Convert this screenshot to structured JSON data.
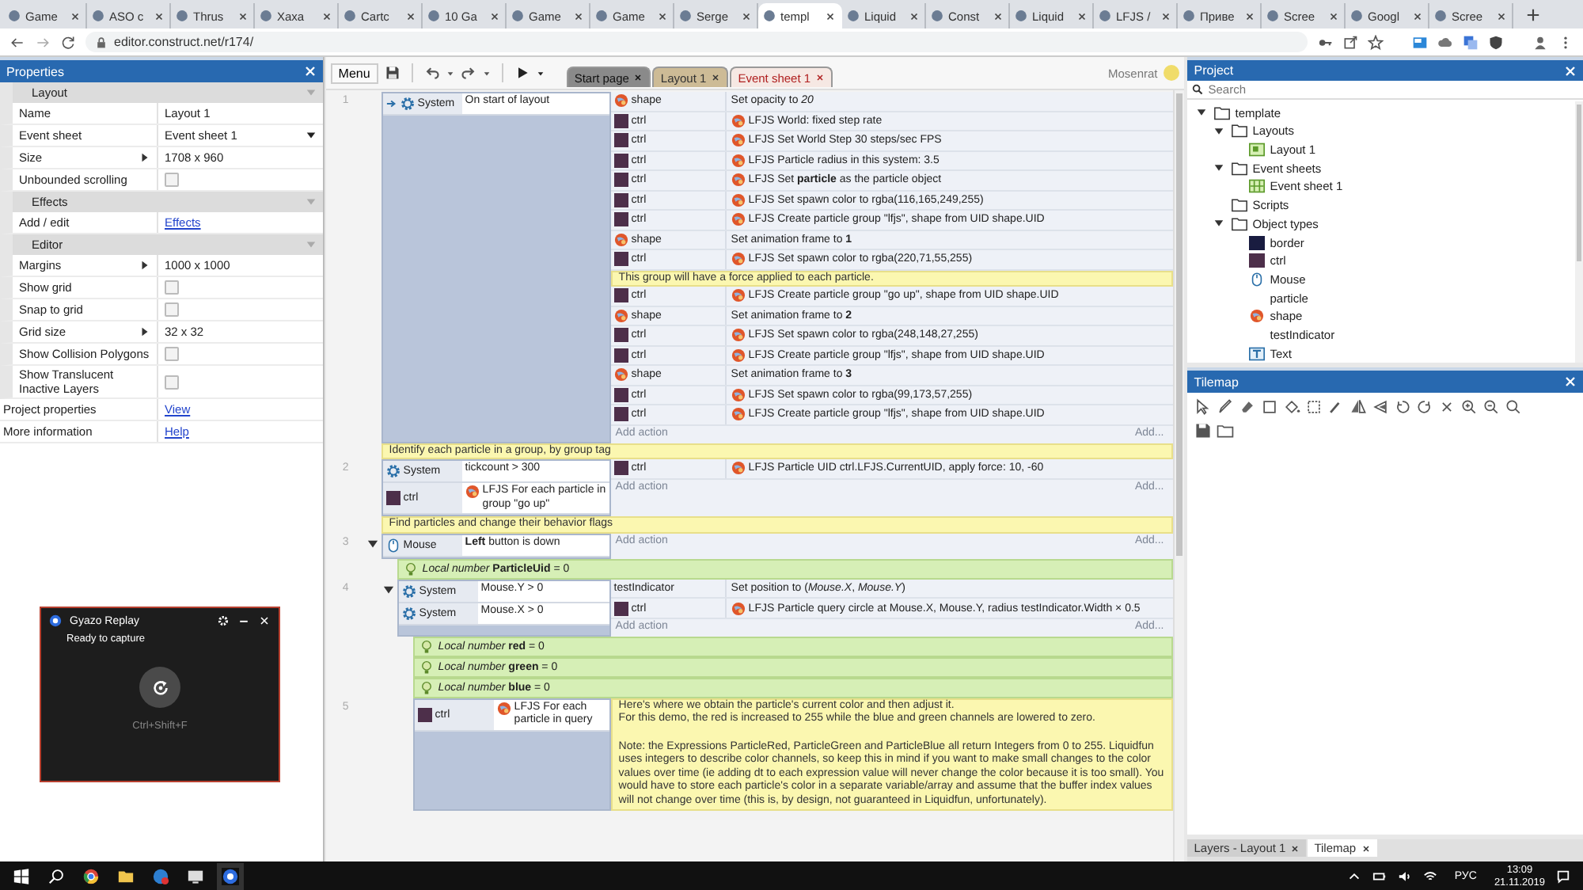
{
  "browser": {
    "tabs": [
      {
        "title": "Game",
        "selected": false
      },
      {
        "title": "ASO c",
        "selected": false
      },
      {
        "title": "Thrus",
        "selected": false
      },
      {
        "title": "Xaxa",
        "selected": false
      },
      {
        "title": "Cartc",
        "selected": false
      },
      {
        "title": "10 Ga",
        "selected": false
      },
      {
        "title": "Game",
        "selected": false
      },
      {
        "title": "Game",
        "selected": false
      },
      {
        "title": "Serge",
        "selected": false
      },
      {
        "title": "templ",
        "selected": true
      },
      {
        "title": "Liquid",
        "selected": false
      },
      {
        "title": "Const",
        "selected": false
      },
      {
        "title": "Liquid",
        "selected": false
      },
      {
        "title": "LFJS /",
        "selected": false
      },
      {
        "title": "Приве",
        "selected": false
      },
      {
        "title": "Scree",
        "selected": false
      },
      {
        "title": "Googl",
        "selected": false
      },
      {
        "title": "Scree",
        "selected": false
      }
    ],
    "url": "editor.construct.net/r174/"
  },
  "properties": {
    "title": "Properties",
    "sections": [
      {
        "title": "Layout",
        "expanded": true,
        "rows": [
          {
            "kind": "text",
            "label": "Name",
            "value": "Layout 1"
          },
          {
            "kind": "dropdown",
            "label": "Event sheet",
            "value": "Event sheet 1"
          },
          {
            "kind": "expand",
            "label": "Size",
            "value": "1708 x 960"
          },
          {
            "kind": "checkbox",
            "label": "Unbounded scrolling",
            "checked": false
          }
        ]
      },
      {
        "title": "Effects",
        "expanded": true,
        "rows": [
          {
            "kind": "link",
            "label": "Add / edit",
            "value": "Effects"
          }
        ]
      },
      {
        "title": "Editor",
        "expanded": true,
        "rows": [
          {
            "kind": "expand",
            "label": "Margins",
            "value": "1000 x 1000"
          },
          {
            "kind": "checkbox",
            "label": "Show grid",
            "checked": false
          },
          {
            "kind": "checkbox",
            "label": "Snap to grid",
            "checked": false
          },
          {
            "kind": "expand",
            "label": "Grid size",
            "value": "32 x 32"
          },
          {
            "kind": "checkbox",
            "label": "Show Collision Polygons",
            "checked": false
          },
          {
            "kind": "checkbox",
            "label": "Show Translucent Inactive Layers",
            "checked": false
          }
        ]
      }
    ],
    "rows": [
      {
        "kind": "link",
        "label": "Project properties",
        "value": "View"
      },
      {
        "kind": "link",
        "label": "More information",
        "value": "Help"
      }
    ]
  },
  "toolbar": {
    "menu": "Menu",
    "tabs": [
      {
        "kind": "start",
        "label": "Start page",
        "selected": false
      },
      {
        "kind": "layout",
        "label": "Layout 1",
        "selected": false
      },
      {
        "kind": "sheet",
        "label": "Event sheet 1",
        "selected": true
      }
    ],
    "user": "Mosenrat"
  },
  "sheet": {
    "events": [
      {
        "kind": "event",
        "number": "1",
        "conditions": [
          {
            "kind": "system",
            "object": "System",
            "trigger": true,
            "text": "On start of layout"
          }
        ],
        "actions": [
          {
            "kind": "shape",
            "object": "shape",
            "text": "Set opacity to *20*"
          },
          {
            "kind": "sprite",
            "object": "ctrl",
            "behavior": true,
            "text": "LFJS World: fixed step rate"
          },
          {
            "kind": "sprite",
            "object": "ctrl",
            "behavior": true,
            "text": "LFJS Set World Step 30 steps/sec FPS"
          },
          {
            "kind": "sprite",
            "object": "ctrl",
            "behavior": true,
            "text": "LFJS Particle radius in this system: 3.5"
          },
          {
            "kind": "sprite",
            "object": "ctrl",
            "behavior": true,
            "text": "LFJS Set **particle** as the particle object"
          },
          {
            "kind": "sprite",
            "object": "ctrl",
            "behavior": true,
            "text": "LFJS Set spawn color to rgba(116,165,249,255)"
          },
          {
            "kind": "sprite",
            "object": "ctrl",
            "behavior": true,
            "text": "LFJS Create particle group \"lfjs\", shape from UID shape.UID"
          },
          {
            "kind": "shape",
            "object": "shape",
            "text": "Set animation frame to **1**"
          },
          {
            "kind": "sprite",
            "object": "ctrl",
            "behavior": true,
            "text": "LFJS Set spawn color to rgba(220,71,55,255)"
          },
          {
            "kind": "comment",
            "text": "This group will have a force applied to each particle."
          },
          {
            "kind": "sprite",
            "object": "ctrl",
            "behavior": true,
            "text": "LFJS Create particle group \"go up\", shape from UID shape.UID"
          },
          {
            "kind": "shape",
            "object": "shape",
            "text": "Set animation frame to **2**"
          },
          {
            "kind": "sprite",
            "object": "ctrl",
            "behavior": true,
            "text": "LFJS Set spawn color to rgba(248,148,27,255)"
          },
          {
            "kind": "sprite",
            "object": "ctrl",
            "behavior": true,
            "text": "LFJS Create particle group \"lfjs\", shape from UID shape.UID"
          },
          {
            "kind": "shape",
            "object": "shape",
            "text": "Set animation frame to **3**"
          },
          {
            "kind": "sprite",
            "object": "ctrl",
            "behavior": true,
            "text": "LFJS Set spawn color to rgba(99,173,57,255)"
          },
          {
            "kind": "sprite",
            "object": "ctrl",
            "behavior": true,
            "text": "LFJS Create particle group \"lfjs\", shape from UID shape.UID"
          }
        ],
        "add_action": "Add action",
        "add": "Add..."
      },
      {
        "kind": "comment",
        "text": "Identify each particle in a group, by group tag"
      },
      {
        "kind": "event",
        "number": "2",
        "conditions": [
          {
            "kind": "system",
            "object": "System",
            "text": "tickcount > 300"
          },
          {
            "kind": "sprite",
            "object": "ctrl",
            "behavior": true,
            "text": "LFJS For each particle in group \"go up\""
          }
        ],
        "actions": [
          {
            "kind": "sprite",
            "object": "ctrl",
            "behavior": true,
            "text": "LFJS Particle UID ctrl.LFJS.CurrentUID, apply force: 10, -60"
          }
        ],
        "add_action": "Add action",
        "add": "Add..."
      },
      {
        "kind": "comment",
        "text": "Find particles and change their behavior flags"
      },
      {
        "kind": "event",
        "number": "3",
        "expanded": true,
        "conditions": [
          {
            "kind": "mouse",
            "object": "Mouse",
            "text": "**Left** button is down"
          }
        ],
        "add_action": "Add action",
        "add": "Add...",
        "children": [
          {
            "kind": "variable",
            "text": "*Local number* **ParticleUid** = 0"
          },
          {
            "kind": "event",
            "number": "4",
            "expanded": true,
            "conditions": [
              {
                "kind": "system",
                "object": "System",
                "text": "Mouse.Y > 0"
              },
              {
                "kind": "system",
                "object": "System",
                "text": "Mouse.X > 0"
              }
            ],
            "actions": [
              {
                "kind": "plain",
                "object": "testIndicator",
                "text": "Set position to (*Mouse.X*, *Mouse.Y*)"
              },
              {
                "kind": "sprite",
                "object": "ctrl",
                "behavior": true,
                "text": "LFJS Particle query circle at Mouse.X, Mouse.Y, radius testIndicator.Width × 0.5"
              }
            ],
            "add_action": "Add action",
            "add": "Add...",
            "children": [
              {
                "kind": "variable",
                "text": "*Local number* **red** = 0"
              },
              {
                "kind": "variable",
                "text": "*Local number* **green** = 0"
              },
              {
                "kind": "variable",
                "text": "*Local number* **blue** = 0"
              },
              {
                "kind": "event",
                "number": "5",
                "conditions": [
                  {
                    "kind": "sprite",
                    "object": "ctrl",
                    "behavior": true,
                    "text": "LFJS For each particle in query"
                  }
                ],
                "actions": [
                  {
                    "kind": "comment",
                    "text": "Here's where we obtain the particle's current color and then adjust it.\nFor this demo, the red is increased to 255 while the blue and green channels are lowered to zero.\n\nNote: the Expressions ParticleRed, ParticleGreen and ParticleBlue all return Integers from 0 to 255. Liquidfun uses integers to describe color channels, so keep this in mind if you want to make small changes to the color values over time (ie adding dt to each expression value will never change the color because it is too small). You would have to store each particle's color in a separate variable/array and assume that the buffer index values will not change over time (this is, by design, not guaranteed in Liquidfun, unfortunately)."
                  }
                ]
              }
            ]
          }
        ]
      }
    ]
  },
  "project": {
    "title": "Project",
    "search": {
      "placeholder": "Search"
    },
    "tree": [
      {
        "kind": "folder",
        "label": "template",
        "expanded": true,
        "children": [
          {
            "kind": "folder",
            "label": "Layouts",
            "expanded": true,
            "children": [
              {
                "kind": "layout",
                "label": "Layout 1"
              }
            ]
          },
          {
            "kind": "folder",
            "label": "Event sheets",
            "expanded": true,
            "children": [
              {
                "kind": "eventsheet",
                "label": "Event sheet 1"
              }
            ]
          },
          {
            "kind": "folder",
            "label": "Scripts"
          },
          {
            "kind": "folder",
            "label": "Object types",
            "expanded": true,
            "children": [
              {
                "kind": "sprite",
                "label": "border",
                "color": "#191c40"
              },
              {
                "kind": "sprite",
                "label": "ctrl",
                "color": "#4d2f4a"
              },
              {
                "kind": "mouse",
                "label": "Mouse"
              },
              {
                "kind": "plain",
                "label": "particle"
              },
              {
                "kind": "shape",
                "label": "shape"
              },
              {
                "kind": "plain",
                "label": "testIndicator"
              },
              {
                "kind": "text",
                "label": "Text"
              }
            ]
          }
        ]
      }
    ]
  },
  "tilemap": {
    "title": "Tilemap"
  },
  "bottom_tabs": [
    {
      "label": "Layers - Layout 1",
      "selected": false
    },
    {
      "label": "Tilemap",
      "selected": true
    }
  ],
  "gyazo": {
    "title": "Gyazo Replay",
    "status": "Ready to capture",
    "shortcut": "Ctrl+Shift+F"
  },
  "taskbar": {
    "language": "РУС",
    "time": "13:09",
    "date": "21.11.2019"
  }
}
